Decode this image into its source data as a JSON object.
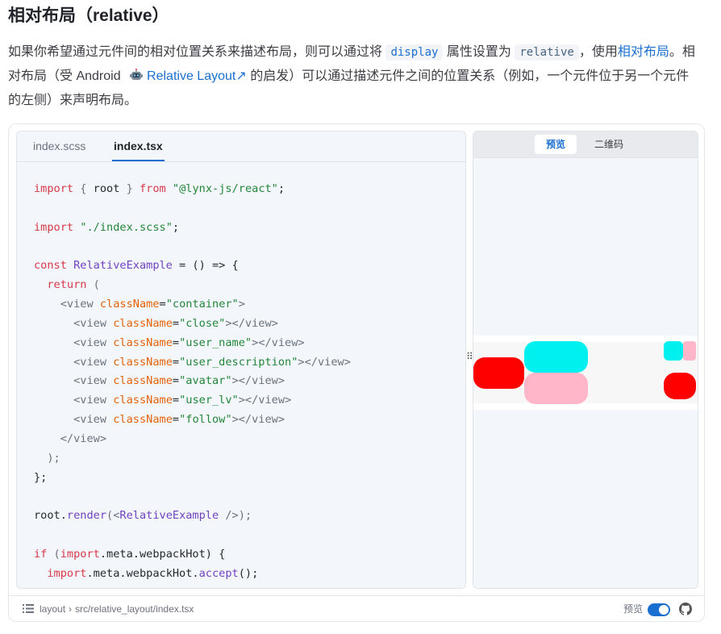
{
  "heading": "相对布局（relative）",
  "intro": {
    "text1": "如果你希望通过元件间的相对位置关系来描述布局，则可以通过将 ",
    "code_display": "display",
    "text2": " 属性设置为 ",
    "code_relative": "relative",
    "text3": "，使用",
    "link_relative_layout": "相对布局",
    "text4": "。相对布局（受 Android ",
    "link_android": "Relative Layout",
    "link_arrow": "↗",
    "text5": " 的启发）可以通过描述元件之间的位置关系（例如，一个元件位于另一个元件的左侧）来声明布局。"
  },
  "editor": {
    "tabs": [
      {
        "label": "index.scss",
        "active": false
      },
      {
        "label": "index.tsx",
        "active": true
      }
    ]
  },
  "code": {
    "l1_import": "import",
    "l1_braces_open": " { ",
    "l1_root": "root",
    "l1_braces_close": " } ",
    "l1_from": "from",
    "l1_module": "\"@lynx-js/react\"",
    "l1_end": ";",
    "l3_import": "import",
    "l3_module": "\"./index.scss\"",
    "l3_end": ";",
    "l5_const": "const",
    "l5_name": "RelativeExample",
    "l5_rest": " = () => {",
    "l6_return": "return",
    "l6_paren": " (",
    "l7_open": "<view ",
    "l7_attr": "className",
    "l7_eq": "=",
    "l7_val": "\"container\"",
    "l7_close": ">",
    "children": [
      {
        "cls": "\"close\""
      },
      {
        "cls": "\"user_name\""
      },
      {
        "cls": "\"user_description\""
      },
      {
        "cls": "\"avatar\""
      },
      {
        "cls": "\"user_lv\""
      },
      {
        "cls": "\"follow\""
      }
    ],
    "child_open": "<view ",
    "child_attr": "className",
    "child_eq": "=",
    "child_close": "></view>",
    "l14_close": "</view>",
    "l15": ");",
    "l16": "};",
    "l18_root": "root.",
    "l18_render": "render",
    "l18_paren": "(<",
    "l18_name": "RelativeExample",
    "l18_end": " />);",
    "l20_if": "if",
    "l20_paren": " (",
    "l20_import": "import",
    "l20_rest": ".meta.webpackHot) {",
    "l21_import": "import",
    "l21_rest": ".meta.webpackHot.",
    "l21_accept": "accept",
    "l21_end": "();"
  },
  "preview": {
    "tabs": [
      {
        "label": "预览",
        "active": true
      },
      {
        "label": "二维码",
        "active": false
      }
    ],
    "colors": {
      "red": "#ff0000",
      "cyan": "#00f0f0",
      "pink": "#ffb6c8"
    }
  },
  "footer": {
    "crumb_root": "layout",
    "crumb_sep": "›",
    "crumb_path": "src/relative_layout/index.tsx",
    "toggle_label": "预览",
    "toggle_on": true
  }
}
